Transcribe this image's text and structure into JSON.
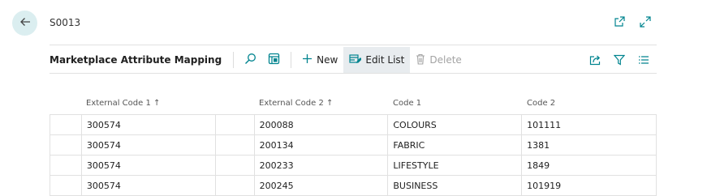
{
  "header": {
    "record_title": "S0013"
  },
  "actionbar": {
    "page_caption": "Marketplace Attribute Mapping",
    "new_label": "New",
    "edit_list_label": "Edit List",
    "delete_label": "Delete"
  },
  "table": {
    "columns": [
      "External Code 1",
      "External Code 2",
      "Code 1",
      "Code 2"
    ],
    "sort_indicator": "↑",
    "rows": [
      [
        "300574",
        "200088",
        "COLOURS",
        "101111"
      ],
      [
        "300574",
        "200134",
        "FABRIC",
        "1381"
      ],
      [
        "300574",
        "200233",
        "LIFESTYLE",
        "1849"
      ],
      [
        "300574",
        "200245",
        "BUSINESS",
        "101919"
      ]
    ]
  },
  "colors": {
    "accent": "#00848f",
    "back_button_bg": "#dbeef0",
    "grid_line": "#e1e1e1"
  }
}
